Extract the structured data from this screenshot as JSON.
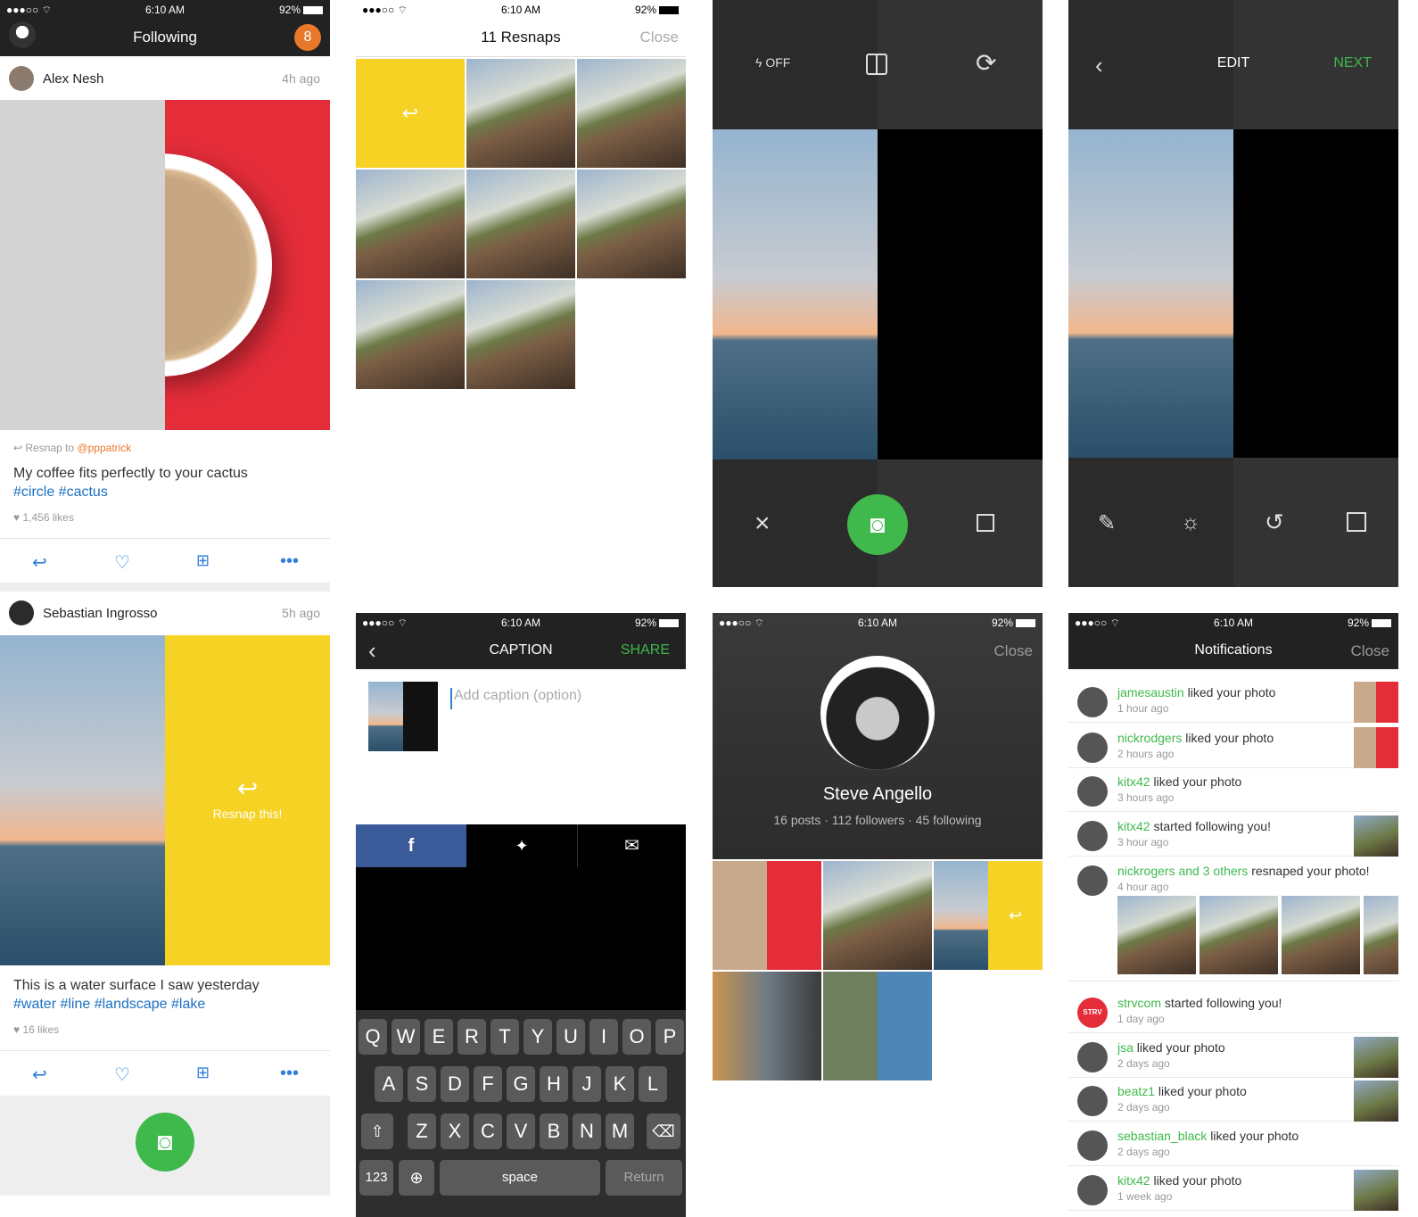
{
  "status": {
    "time": "6:10 AM",
    "battery": "92%"
  },
  "feed": {
    "title": "Following",
    "badge": "8",
    "post1": {
      "user": "Alex Nesh",
      "ago": "4h ago",
      "resnap_prefix": "Resnap to ",
      "resnap_user": "@pppatrick",
      "caption": "My coffee fits perfectly to your cactus",
      "tags": "#circle #cactus",
      "likes": "1,456 likes"
    },
    "post2": {
      "user": "Sebastian Ingrosso",
      "ago": "5h ago",
      "overlay": "Resnap this!",
      "caption": "This is a water surface I saw yesterday",
      "tags": "#water #line #landscape #lake",
      "likes": "16 likes"
    }
  },
  "resnaps": {
    "title": "11 Resnaps",
    "close": "Close"
  },
  "camera": {
    "flash": "OFF"
  },
  "edit": {
    "title": "EDIT",
    "next": "NEXT"
  },
  "caption": {
    "title": "CAPTION",
    "share": "SHARE",
    "placeholder": "Add caption (option)"
  },
  "keyboard": {
    "row1": [
      "Q",
      "W",
      "E",
      "R",
      "T",
      "Y",
      "U",
      "I",
      "O",
      "P"
    ],
    "row2": [
      "A",
      "S",
      "D",
      "F",
      "G",
      "H",
      "J",
      "K",
      "L"
    ],
    "row3": [
      "Z",
      "X",
      "C",
      "V",
      "B",
      "N",
      "M"
    ],
    "num": "123",
    "space": "space",
    "ret": "Return"
  },
  "profile": {
    "close": "Close",
    "name": "Steve Angello",
    "stats": "16 posts · 112 followers · 45 following"
  },
  "notifications": {
    "title": "Notifications",
    "close": "Close",
    "items": [
      {
        "user": "jamesaustin",
        "text": " liked your photo",
        "ago": "1 hour ago"
      },
      {
        "user": "nickrodgers",
        "text": " liked your photo",
        "ago": "2 hours ago"
      },
      {
        "user": "kitx42",
        "text": " liked your photo",
        "ago": "3 hours ago"
      },
      {
        "user": "kitx42",
        "text": " started following you!",
        "ago": "3 hour ago"
      },
      {
        "user": "nickrogers and 3 others",
        "text": " resnaped your photo!",
        "ago": "4 hour ago"
      },
      {
        "user": "strvcom",
        "text": " started following you!",
        "ago": "1 day ago"
      },
      {
        "user": "jsa",
        "text": " liked your photo",
        "ago": "2 days  ago"
      },
      {
        "user": "beatz1",
        "text": " liked your photo",
        "ago": "2 days ago"
      },
      {
        "user": "sebastian_black",
        "text": " liked your photo",
        "ago": "2 days ago"
      },
      {
        "user": "kitx42",
        "text": " liked your photo",
        "ago": "1 week ago"
      }
    ],
    "strv_badge": "STRV"
  },
  "colors": {
    "accent": "#3fb94b",
    "link": "#1b6fc1",
    "orange": "#e8782b",
    "yellow": "#f5d223",
    "red": "#e52d3a",
    "facebook": "#3b5a9a"
  },
  "icons": [
    "share-arrow-icon",
    "heart-icon",
    "grid-icon",
    "more-icon",
    "camera-icon",
    "flash-icon",
    "layout-icon",
    "flip-camera-icon",
    "close-icon",
    "layers-icon",
    "back-icon",
    "brush-icon",
    "brightness-icon",
    "rotate-icon",
    "crop-icon",
    "facebook-icon",
    "twitter-icon",
    "mail-icon",
    "shift-icon",
    "delete-icon",
    "globe-icon"
  ]
}
